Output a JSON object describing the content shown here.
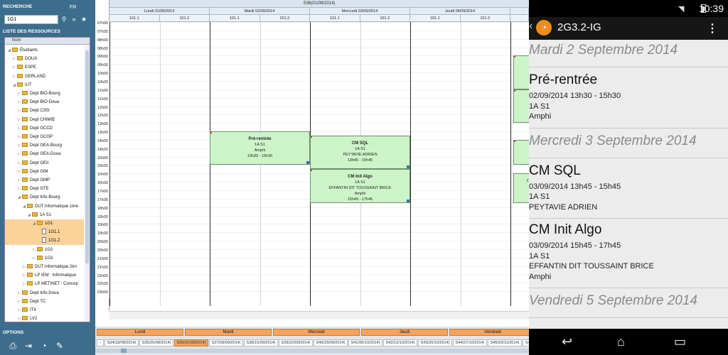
{
  "search": {
    "section": "RECHERCHE",
    "lang": "FR",
    "value": "1G1"
  },
  "resources": {
    "section": "LISTE DES RESSOURCES",
    "column": "Nom",
    "tree": [
      {
        "label": "Étudiants",
        "d": 0,
        "t": "minus",
        "f": 1
      },
      {
        "label": "DOUA",
        "d": 1,
        "t": "plus",
        "f": 1
      },
      {
        "label": "ESPE",
        "d": 1,
        "t": "plus",
        "f": 1
      },
      {
        "label": "GERLAND",
        "d": 1,
        "t": "plus",
        "f": 1
      },
      {
        "label": "IUT",
        "d": 1,
        "t": "minus",
        "f": 1
      },
      {
        "label": "Dept BIO-Bourg",
        "d": 2,
        "t": "plus",
        "f": 1
      },
      {
        "label": "Dept BIO-Doua",
        "d": 2,
        "t": "plus",
        "f": 1
      },
      {
        "label": "Dept C3SI",
        "d": 2,
        "t": "plus",
        "f": 1
      },
      {
        "label": "Dept CHIMIE",
        "d": 2,
        "t": "plus",
        "f": 1
      },
      {
        "label": "Dept GCCD",
        "d": 2,
        "t": "plus",
        "f": 1
      },
      {
        "label": "Dept GCGP",
        "d": 2,
        "t": "plus",
        "f": 1
      },
      {
        "label": "Dept GEA-Bourg",
        "d": 2,
        "t": "plus",
        "f": 1
      },
      {
        "label": "Dept GEA-Doua",
        "d": 2,
        "t": "plus",
        "f": 1
      },
      {
        "label": "Dept GEII",
        "d": 2,
        "t": "plus",
        "f": 1
      },
      {
        "label": "Dept GIM",
        "d": 2,
        "t": "plus",
        "f": 1
      },
      {
        "label": "Dept GMP",
        "d": 2,
        "t": "plus",
        "f": 1
      },
      {
        "label": "Dept GTE",
        "d": 2,
        "t": "plus",
        "f": 1
      },
      {
        "label": "Dept Info-Bourg",
        "d": 2,
        "t": "minus",
        "f": 1
      },
      {
        "label": "DUT Informatique 1ère",
        "d": 3,
        "t": "minus",
        "f": 1
      },
      {
        "label": "1A S1",
        "d": 4,
        "t": "minus",
        "f": 1
      },
      {
        "label": "1G1",
        "d": 5,
        "t": "minus",
        "f": 1,
        "sel": 1
      },
      {
        "label": "1G1.1",
        "d": 6,
        "t": "",
        "f": 0,
        "sel": 1
      },
      {
        "label": "1G1.2",
        "d": 6,
        "t": "",
        "f": 0,
        "sel": 1
      },
      {
        "label": "1G2",
        "d": 5,
        "t": "plus",
        "f": 1
      },
      {
        "label": "1G3",
        "d": 5,
        "t": "plus",
        "f": 1
      },
      {
        "label": "DUT Informatique 2èn",
        "d": 3,
        "t": "plus",
        "f": 1
      },
      {
        "label": "LP IEM : Informatique",
        "d": 3,
        "t": "plus",
        "f": 1
      },
      {
        "label": "LP METINET : Concep",
        "d": 3,
        "t": "plus",
        "f": 1
      },
      {
        "label": "Dept Info-Doua",
        "d": 2,
        "t": "plus",
        "f": 1
      },
      {
        "label": "Dept TC",
        "d": 2,
        "t": "plus",
        "f": 1
      },
      {
        "label": "ITII",
        "d": 2,
        "t": "plus",
        "f": 1
      },
      {
        "label": "LV2",
        "d": 2,
        "t": "plus",
        "f": 1
      },
      {
        "label": "Sciences Techniques",
        "d": 2,
        "t": "plus",
        "f": 1
      }
    ]
  },
  "options": {
    "section": "OPTIONS"
  },
  "calendar": {
    "week": "S36(01/09/2014)",
    "days": [
      "Lundi 01/09/2014",
      "Mardi 02/09/2014",
      "Mercredi 03/09/2014",
      "Jeudi 04/09/2014"
    ],
    "rooms": [
      "101.1",
      "101.2",
      "101.1",
      "101.2",
      "101.1",
      "101.2",
      "101.1",
      "101.2"
    ],
    "times": [
      "07h00",
      "07h30",
      "08h00",
      "08h30",
      "09h00",
      "09h30",
      "10h00",
      "10h30",
      "11h00",
      "11h30",
      "12h00",
      "12h30",
      "13h00",
      "13h30",
      "14h00",
      "14h30",
      "15h00",
      "15h30",
      "16h00",
      "16h30",
      "17h00",
      "17h30",
      "18h00",
      "18h30",
      "19h00",
      "19h30",
      "20h00",
      "20h30",
      "21h00",
      "21h30",
      "22h00",
      "22h30",
      "23h00"
    ],
    "events": [
      {
        "title": "Pré-rentrée",
        "l1": "1A S1",
        "l2": "Amphi",
        "l3": "13h30 - 15h30"
      },
      {
        "title": "CM SQL",
        "l1": "1A S1",
        "l2": "PEYTAVIE ADRIEN",
        "l3": "13h45 - 15h45"
      },
      {
        "title": "CM Init Algo",
        "l1": "1A S1",
        "l2": "EFFANTIN DIT TOUSSAINT BRICE",
        "l3": "Amphi",
        "l4": "15h45 - 17h45"
      }
    ],
    "partial_event_text": "DE"
  },
  "bottom": {
    "days": [
      "Lundi",
      "Mardi",
      "Mercredi",
      "Jeudi",
      "Vendredi"
    ],
    "weeks": [
      "S34(18/08/2014)",
      "S35(25/08/2014)",
      "S36(01/09/2014)",
      "S37(08/09/2014)",
      "S38(15/09/2014)",
      "S39(22/09/2014)",
      "S40(29/09/2014)",
      "S41(06/10/2014)",
      "S42(13/10/2014)",
      "S43(20/10/2014)",
      "S44(27/10/2014)",
      "S45(03/11/2014)",
      "S46(10/11/2014)"
    ]
  },
  "phone": {
    "time": "10:39",
    "title": "2G3.2-IG",
    "sections": [
      {
        "day": "Mardi 2 Septembre 2014"
      },
      {
        "title": "Pré-rentrée",
        "lines": [
          "02/09/2014 13h30 - 15h30",
          "1A S1",
          "Amphi"
        ]
      },
      {
        "day": "Mercredi 3 Septembre 2014"
      },
      {
        "title": "CM SQL",
        "lines": [
          "03/09/2014 13h45 - 15h45",
          "1A S1",
          "PEYTAVIE ADRIEN"
        ]
      },
      {
        "title": "CM Init Algo",
        "lines": [
          "03/09/2014 15h45 - 17h45",
          "1A S1",
          "EFFANTIN DIT TOUSSAINT BRICE",
          "Amphi"
        ]
      },
      {
        "day": "Vendredi 5 Septembre 2014"
      }
    ]
  }
}
